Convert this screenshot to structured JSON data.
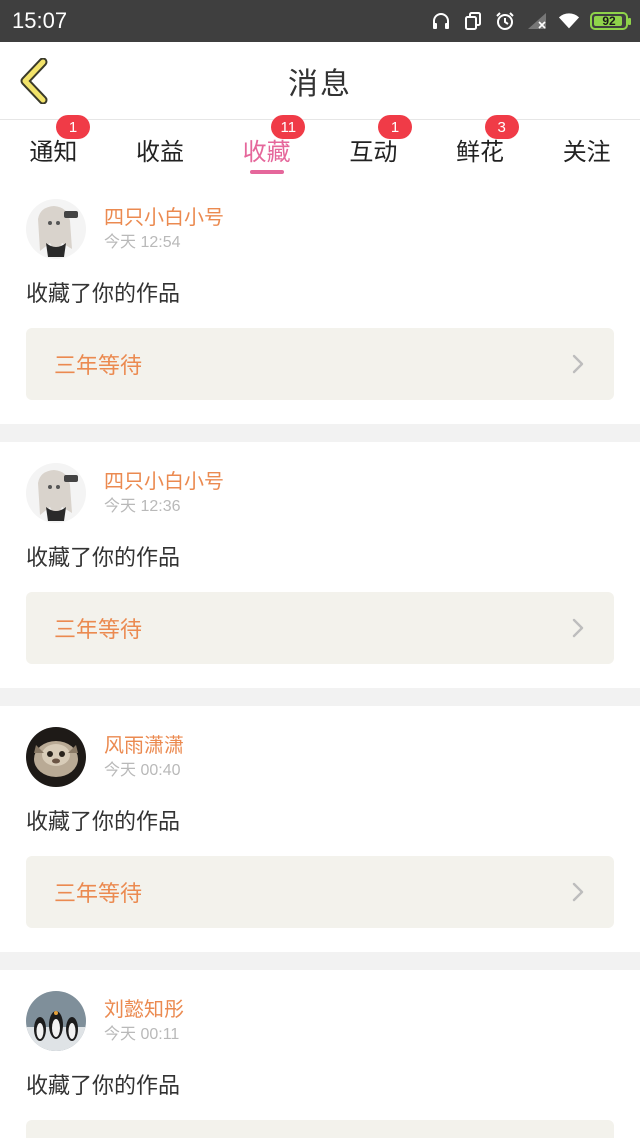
{
  "status_bar": {
    "time": "15:07",
    "battery": "92",
    "battery_level": 0.92
  },
  "header": {
    "title": "消息"
  },
  "tabs": [
    {
      "label": "通知",
      "badge": "1",
      "active": false
    },
    {
      "label": "收益",
      "badge": "",
      "active": false
    },
    {
      "label": "收藏",
      "badge": "11",
      "active": true
    },
    {
      "label": "互动",
      "badge": "1",
      "active": false
    },
    {
      "label": "鲜花",
      "badge": "3",
      "active": false
    },
    {
      "label": "关注",
      "badge": "",
      "active": false
    }
  ],
  "items": [
    {
      "user": "四只小白小号",
      "time": "今天 12:54",
      "action": "收藏了你的作品",
      "work": "三年等待"
    },
    {
      "user": "四只小白小号",
      "time": "今天 12:36",
      "action": "收藏了你的作品",
      "work": "三年等待"
    },
    {
      "user": "风雨潇潇",
      "time": "今天 00:40",
      "action": "收藏了你的作品",
      "work": "三年等待"
    },
    {
      "user": "刘懿知彤",
      "time": "今天 00:11",
      "action": "收藏了你的作品",
      "work": ""
    }
  ],
  "colors": {
    "accent": "#e5679b",
    "username": "#eb8a50",
    "badge": "#f03b47",
    "status_bar": "#3f3f3f"
  },
  "icons": {
    "back": "chevron-left-icon",
    "headphones": "headphones-icon",
    "alarm": "alarm-icon",
    "signal": "signal-icon",
    "wifi": "wifi-icon",
    "arrow": "chevron-right-icon"
  }
}
